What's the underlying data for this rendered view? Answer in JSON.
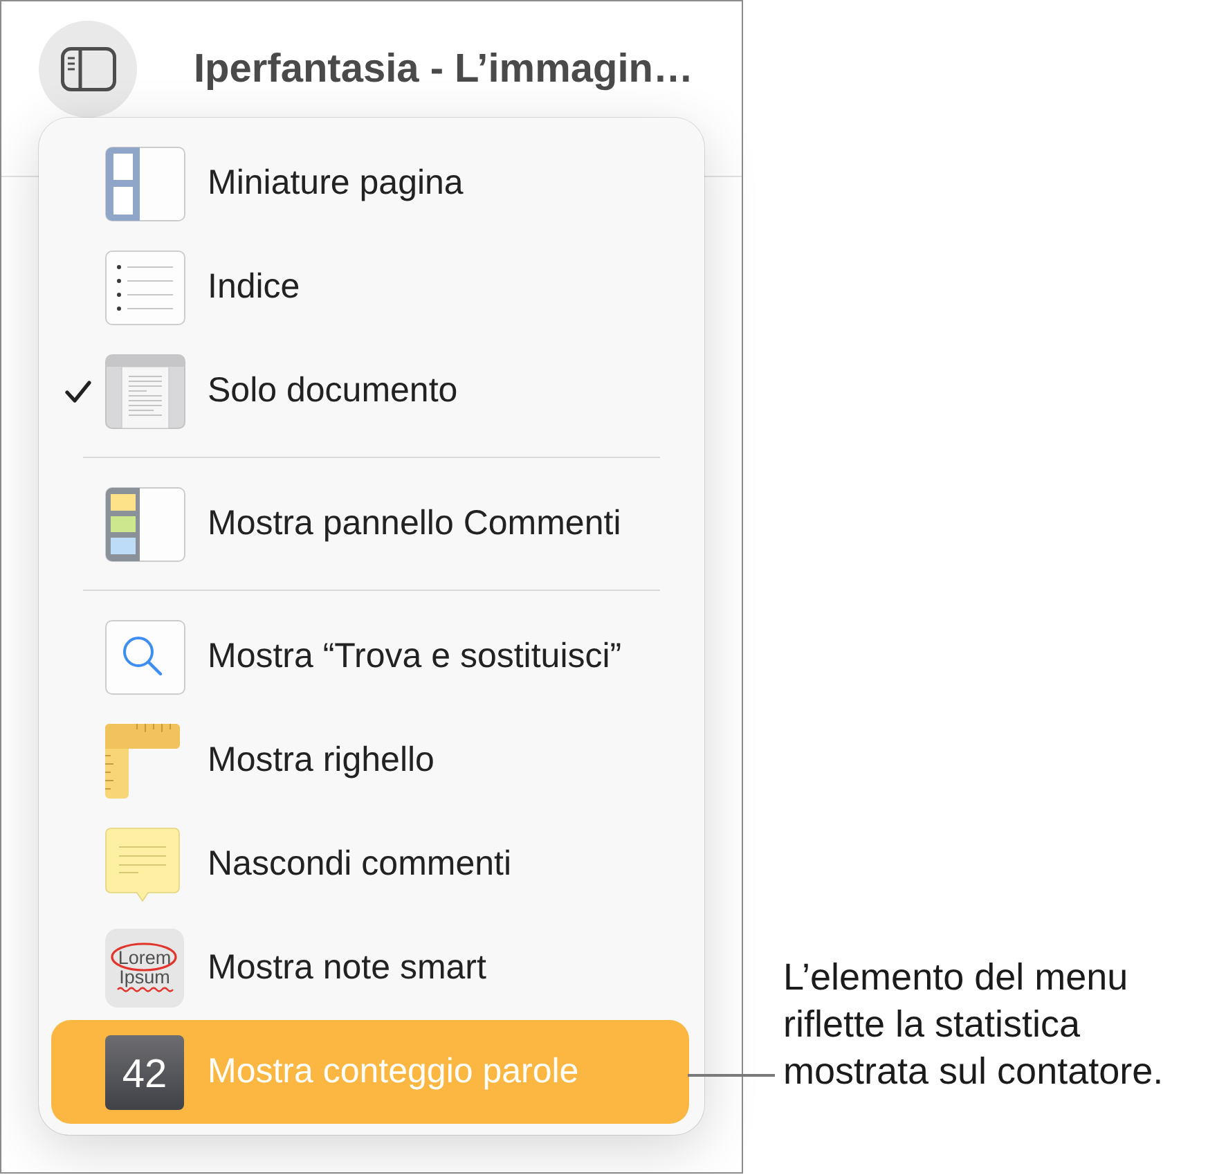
{
  "window": {
    "title": "Iperfantasia - L’immagin…"
  },
  "view_menu": {
    "sections": [
      {
        "items": [
          {
            "label": "Miniature pagina",
            "checked": false,
            "selected": false
          },
          {
            "label": "Indice",
            "checked": false,
            "selected": false
          },
          {
            "label": "Solo documento",
            "checked": true,
            "selected": false
          }
        ]
      },
      {
        "items": [
          {
            "label": "Mostra pannello Commenti",
            "checked": false,
            "selected": false
          }
        ]
      },
      {
        "items": [
          {
            "label": "Mostra “Trova e sostituisci”",
            "checked": false,
            "selected": false
          },
          {
            "label": "Mostra righello",
            "checked": false,
            "selected": false
          },
          {
            "label": "Nascondi commenti",
            "checked": false,
            "selected": false
          },
          {
            "label": "Mostra note smart",
            "icon_lines": [
              "Lorem",
              "Ipsum"
            ],
            "checked": false,
            "selected": false
          },
          {
            "label": "Mostra conteggio parole",
            "icon_lines": [
              "42"
            ],
            "checked": false,
            "selected": true
          }
        ]
      }
    ]
  },
  "callout": {
    "text": "L’elemento del menu riflette la statistica mostrata sul contatore."
  }
}
